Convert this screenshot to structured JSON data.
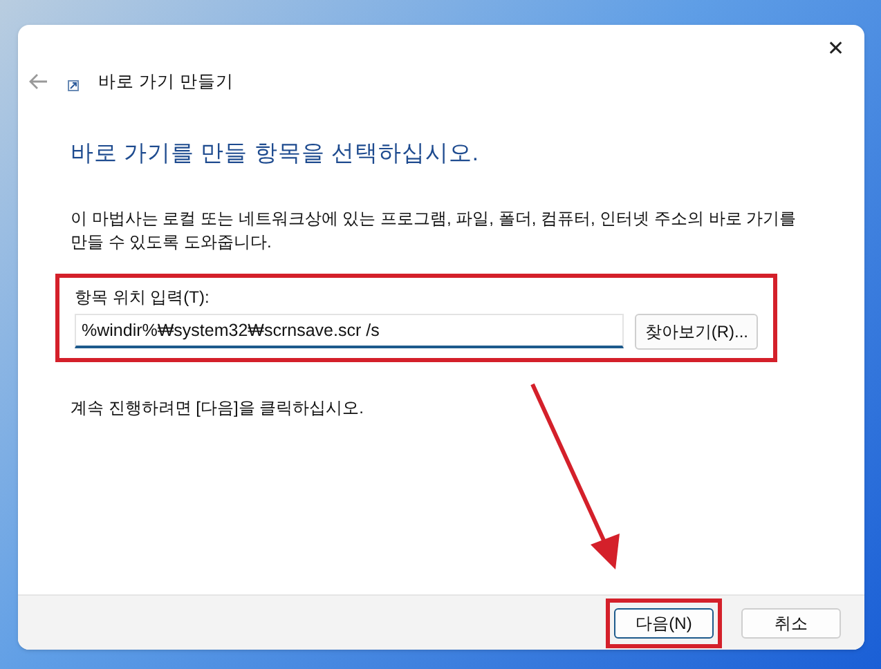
{
  "window": {
    "title": "바로 가기 만들기",
    "close": "✕"
  },
  "heading": "바로 가기를 만들 항목을 선택하십시오.",
  "description": "이 마법사는 로컬 또는 네트워크상에 있는 프로그램, 파일, 폴더, 컴퓨터, 인터넷 주소의 바로 가기를 만들 수 있도록 도와줍니다.",
  "location": {
    "label": "항목 위치 입력(T):",
    "value": "%windir%₩system32₩scrnsave.scr /s",
    "browse": "찾아보기(R)...",
    "highlighted": true
  },
  "instruction": "계속 진행하려면 [다음]을 클릭하십시오.",
  "buttons": [
    {
      "label": "다음(N)",
      "default": true,
      "highlighted": true
    },
    {
      "label": "취소",
      "default": false,
      "highlighted": false
    }
  ]
}
